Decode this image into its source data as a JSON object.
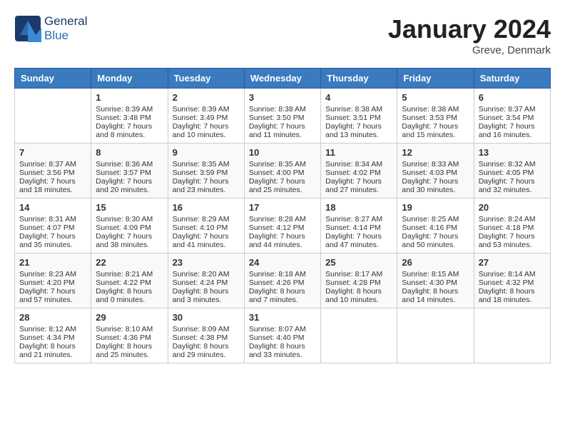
{
  "header": {
    "logo_general": "General",
    "logo_blue": "Blue",
    "month_title": "January 2024",
    "subtitle": "Greve, Denmark"
  },
  "weekdays": [
    "Sunday",
    "Monday",
    "Tuesday",
    "Wednesday",
    "Thursday",
    "Friday",
    "Saturday"
  ],
  "weeks": [
    [
      {
        "day": "",
        "sunrise": "",
        "sunset": "",
        "daylight": ""
      },
      {
        "day": "1",
        "sunrise": "Sunrise: 8:39 AM",
        "sunset": "Sunset: 3:48 PM",
        "daylight": "Daylight: 7 hours and 8 minutes."
      },
      {
        "day": "2",
        "sunrise": "Sunrise: 8:39 AM",
        "sunset": "Sunset: 3:49 PM",
        "daylight": "Daylight: 7 hours and 10 minutes."
      },
      {
        "day": "3",
        "sunrise": "Sunrise: 8:38 AM",
        "sunset": "Sunset: 3:50 PM",
        "daylight": "Daylight: 7 hours and 11 minutes."
      },
      {
        "day": "4",
        "sunrise": "Sunrise: 8:38 AM",
        "sunset": "Sunset: 3:51 PM",
        "daylight": "Daylight: 7 hours and 13 minutes."
      },
      {
        "day": "5",
        "sunrise": "Sunrise: 8:38 AM",
        "sunset": "Sunset: 3:53 PM",
        "daylight": "Daylight: 7 hours and 15 minutes."
      },
      {
        "day": "6",
        "sunrise": "Sunrise: 8:37 AM",
        "sunset": "Sunset: 3:54 PM",
        "daylight": "Daylight: 7 hours and 16 minutes."
      }
    ],
    [
      {
        "day": "7",
        "sunrise": "Sunrise: 8:37 AM",
        "sunset": "Sunset: 3:56 PM",
        "daylight": "Daylight: 7 hours and 18 minutes."
      },
      {
        "day": "8",
        "sunrise": "Sunrise: 8:36 AM",
        "sunset": "Sunset: 3:57 PM",
        "daylight": "Daylight: 7 hours and 20 minutes."
      },
      {
        "day": "9",
        "sunrise": "Sunrise: 8:35 AM",
        "sunset": "Sunset: 3:59 PM",
        "daylight": "Daylight: 7 hours and 23 minutes."
      },
      {
        "day": "10",
        "sunrise": "Sunrise: 8:35 AM",
        "sunset": "Sunset: 4:00 PM",
        "daylight": "Daylight: 7 hours and 25 minutes."
      },
      {
        "day": "11",
        "sunrise": "Sunrise: 8:34 AM",
        "sunset": "Sunset: 4:02 PM",
        "daylight": "Daylight: 7 hours and 27 minutes."
      },
      {
        "day": "12",
        "sunrise": "Sunrise: 8:33 AM",
        "sunset": "Sunset: 4:03 PM",
        "daylight": "Daylight: 7 hours and 30 minutes."
      },
      {
        "day": "13",
        "sunrise": "Sunrise: 8:32 AM",
        "sunset": "Sunset: 4:05 PM",
        "daylight": "Daylight: 7 hours and 32 minutes."
      }
    ],
    [
      {
        "day": "14",
        "sunrise": "Sunrise: 8:31 AM",
        "sunset": "Sunset: 4:07 PM",
        "daylight": "Daylight: 7 hours and 35 minutes."
      },
      {
        "day": "15",
        "sunrise": "Sunrise: 8:30 AM",
        "sunset": "Sunset: 4:09 PM",
        "daylight": "Daylight: 7 hours and 38 minutes."
      },
      {
        "day": "16",
        "sunrise": "Sunrise: 8:29 AM",
        "sunset": "Sunset: 4:10 PM",
        "daylight": "Daylight: 7 hours and 41 minutes."
      },
      {
        "day": "17",
        "sunrise": "Sunrise: 8:28 AM",
        "sunset": "Sunset: 4:12 PM",
        "daylight": "Daylight: 7 hours and 44 minutes."
      },
      {
        "day": "18",
        "sunrise": "Sunrise: 8:27 AM",
        "sunset": "Sunset: 4:14 PM",
        "daylight": "Daylight: 7 hours and 47 minutes."
      },
      {
        "day": "19",
        "sunrise": "Sunrise: 8:25 AM",
        "sunset": "Sunset: 4:16 PM",
        "daylight": "Daylight: 7 hours and 50 minutes."
      },
      {
        "day": "20",
        "sunrise": "Sunrise: 8:24 AM",
        "sunset": "Sunset: 4:18 PM",
        "daylight": "Daylight: 7 hours and 53 minutes."
      }
    ],
    [
      {
        "day": "21",
        "sunrise": "Sunrise: 8:23 AM",
        "sunset": "Sunset: 4:20 PM",
        "daylight": "Daylight: 7 hours and 57 minutes."
      },
      {
        "day": "22",
        "sunrise": "Sunrise: 8:21 AM",
        "sunset": "Sunset: 4:22 PM",
        "daylight": "Daylight: 8 hours and 0 minutes."
      },
      {
        "day": "23",
        "sunrise": "Sunrise: 8:20 AM",
        "sunset": "Sunset: 4:24 PM",
        "daylight": "Daylight: 8 hours and 3 minutes."
      },
      {
        "day": "24",
        "sunrise": "Sunrise: 8:18 AM",
        "sunset": "Sunset: 4:26 PM",
        "daylight": "Daylight: 8 hours and 7 minutes."
      },
      {
        "day": "25",
        "sunrise": "Sunrise: 8:17 AM",
        "sunset": "Sunset: 4:28 PM",
        "daylight": "Daylight: 8 hours and 10 minutes."
      },
      {
        "day": "26",
        "sunrise": "Sunrise: 8:15 AM",
        "sunset": "Sunset: 4:30 PM",
        "daylight": "Daylight: 8 hours and 14 minutes."
      },
      {
        "day": "27",
        "sunrise": "Sunrise: 8:14 AM",
        "sunset": "Sunset: 4:32 PM",
        "daylight": "Daylight: 8 hours and 18 minutes."
      }
    ],
    [
      {
        "day": "28",
        "sunrise": "Sunrise: 8:12 AM",
        "sunset": "Sunset: 4:34 PM",
        "daylight": "Daylight: 8 hours and 21 minutes."
      },
      {
        "day": "29",
        "sunrise": "Sunrise: 8:10 AM",
        "sunset": "Sunset: 4:36 PM",
        "daylight": "Daylight: 8 hours and 25 minutes."
      },
      {
        "day": "30",
        "sunrise": "Sunrise: 8:09 AM",
        "sunset": "Sunset: 4:38 PM",
        "daylight": "Daylight: 8 hours and 29 minutes."
      },
      {
        "day": "31",
        "sunrise": "Sunrise: 8:07 AM",
        "sunset": "Sunset: 4:40 PM",
        "daylight": "Daylight: 8 hours and 33 minutes."
      },
      {
        "day": "",
        "sunrise": "",
        "sunset": "",
        "daylight": ""
      },
      {
        "day": "",
        "sunrise": "",
        "sunset": "",
        "daylight": ""
      },
      {
        "day": "",
        "sunrise": "",
        "sunset": "",
        "daylight": ""
      }
    ]
  ]
}
